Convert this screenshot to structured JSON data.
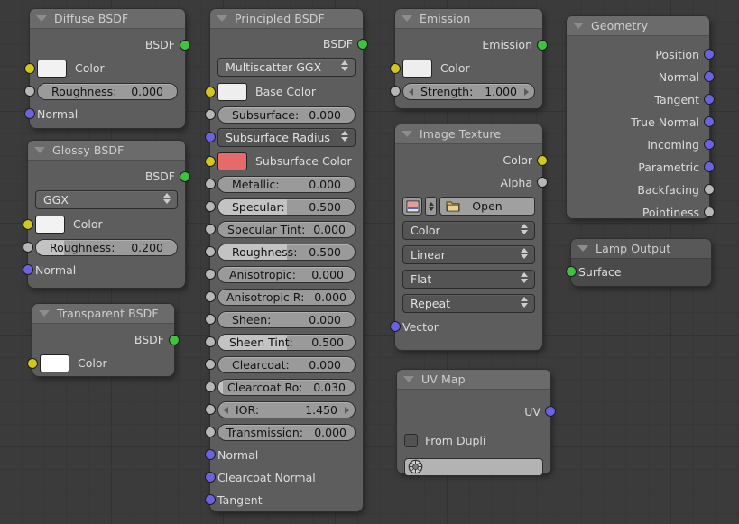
{
  "editor": {
    "name": "blender-node-editor",
    "background": "#3b3b3b"
  },
  "socket_colors": {
    "color": "#d2c71e",
    "value": "#b7b7b7",
    "vector": "#6a62e0",
    "shader": "#3fc23f"
  },
  "nodes": {
    "diffuse_bsdf": {
      "title": "Diffuse BSDF",
      "outputs": [
        {
          "label": "BSDF",
          "type": "shader"
        }
      ],
      "color_label": "Color",
      "color_value": "#f2f2f2",
      "roughness": {
        "label": "Roughness:",
        "value": "0.000",
        "fill": 0
      },
      "normal_label": "Normal"
    },
    "glossy_bsdf": {
      "title": "Glossy BSDF",
      "outputs": [
        {
          "label": "BSDF",
          "type": "shader"
        }
      ],
      "distribution": "GGX",
      "color_label": "Color",
      "color_value": "#f2f2f2",
      "roughness": {
        "label": "Roughness:",
        "value": "0.200",
        "fill": 20
      },
      "normal_label": "Normal"
    },
    "transparent_bsdf": {
      "title": "Transparent BSDF",
      "outputs": [
        {
          "label": "BSDF",
          "type": "shader"
        }
      ],
      "color_label": "Color",
      "color_value": "#ffffff"
    },
    "principled_bsdf": {
      "title": "Principled BSDF",
      "outputs": [
        {
          "label": "BSDF",
          "type": "shader"
        }
      ],
      "distribution": "Multiscatter GGX",
      "base_color_label": "Base Color",
      "base_color_value": "#eeeeee",
      "subsurface_radius": "Subsurface Radius",
      "subsurface_color_label": "Subsurface Color",
      "subsurface_color_value": "#e56b6b",
      "sliders": [
        {
          "label": "Subsurface:",
          "value": "0.000",
          "fill": 0
        },
        {
          "label": "Metallic:",
          "value": "0.000",
          "fill": 0
        },
        {
          "label": "Specular:",
          "value": "0.500",
          "fill": 50
        },
        {
          "label": "Specular Tint:",
          "value": "0.000",
          "fill": 0
        },
        {
          "label": "Roughness:",
          "value": "0.500",
          "fill": 50
        },
        {
          "label": "Anisotropic:",
          "value": "0.000",
          "fill": 0
        },
        {
          "label": "Anisotropic R:",
          "value": "0.000",
          "fill": 0
        },
        {
          "label": "Sheen:",
          "value": "0.000",
          "fill": 0
        },
        {
          "label": "Sheen Tint:",
          "value": "0.500",
          "fill": 50
        },
        {
          "label": "Clearcoat:",
          "value": "0.000",
          "fill": 0
        },
        {
          "label": "Clearcoat Ro:",
          "value": "0.030",
          "fill": 3
        },
        {
          "label": "IOR:",
          "value": "1.450",
          "fill": 0,
          "arrows": true
        },
        {
          "label": "Transmission:",
          "value": "0.000",
          "fill": 0
        }
      ],
      "vector_inputs": [
        "Normal",
        "Clearcoat Normal",
        "Tangent"
      ]
    },
    "emission": {
      "title": "Emission",
      "outputs": [
        {
          "label": "Emission",
          "type": "shader"
        }
      ],
      "color_label": "Color",
      "color_value": "#eeeeee",
      "strength": {
        "label": "Strength:",
        "value": "1.000",
        "arrows": true
      }
    },
    "image_texture": {
      "title": "Image Texture",
      "outputs": [
        {
          "label": "Color",
          "type": "color"
        },
        {
          "label": "Alpha",
          "type": "value"
        }
      ],
      "open_label": "Open",
      "image_icon": "image-thumbnail-icon",
      "folder_icon": "folder-open-icon",
      "enums": [
        "Color",
        "Linear",
        "Flat",
        "Repeat"
      ],
      "vector_input": "Vector"
    },
    "uv_map": {
      "title": "UV Map",
      "outputs": [
        {
          "label": "UV",
          "type": "vector"
        }
      ],
      "from_dupli_label": "From Dupli",
      "from_dupli_checked": false,
      "uv_field_value": "",
      "uv_field_icon": "uv-globe-icon"
    },
    "geometry": {
      "title": "Geometry",
      "outputs": [
        {
          "label": "Position",
          "type": "vector"
        },
        {
          "label": "Normal",
          "type": "vector"
        },
        {
          "label": "Tangent",
          "type": "vector"
        },
        {
          "label": "True Normal",
          "type": "vector"
        },
        {
          "label": "Incoming",
          "type": "vector"
        },
        {
          "label": "Parametric",
          "type": "vector"
        },
        {
          "label": "Backfacing",
          "type": "value"
        },
        {
          "label": "Pointiness",
          "type": "value"
        }
      ]
    },
    "lamp_output": {
      "title": "Lamp Output",
      "inputs": [
        {
          "label": "Surface",
          "type": "shader"
        }
      ]
    }
  }
}
